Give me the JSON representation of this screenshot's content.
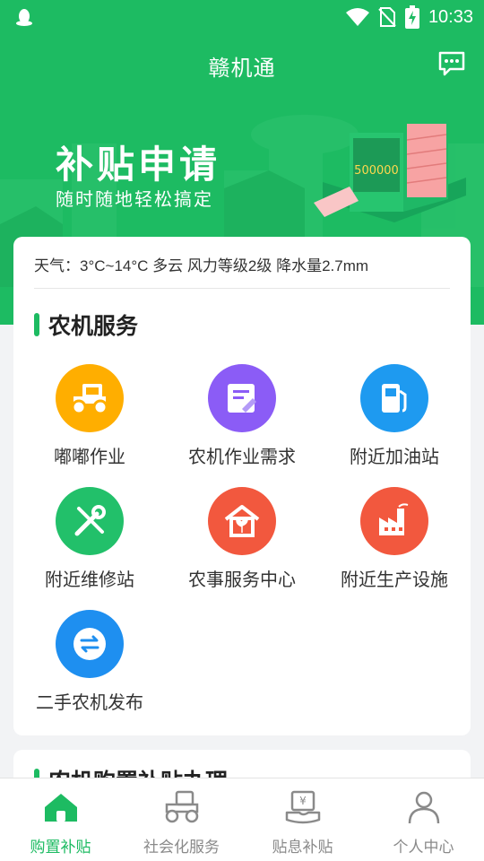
{
  "status_bar": {
    "time": "10:33"
  },
  "header": {
    "title": "赣机通",
    "message_icon": "chat-bubble-icon"
  },
  "banner": {
    "title": "补贴申请",
    "subtitle": "随时随地轻松搞定"
  },
  "weather": {
    "text": "天气：3°C~14°C 多云 风力等级2级 降水量2.7mm"
  },
  "services": {
    "title": "农机服务",
    "items": [
      {
        "label": "嘟嘟作业",
        "icon": "tractor-icon",
        "color": "#ffae00"
      },
      {
        "label": "农机作业需求",
        "icon": "document-edit-icon",
        "color": "#8b5cf6"
      },
      {
        "label": "附近加油站",
        "icon": "fuel-pump-icon",
        "color": "#1e9af0"
      },
      {
        "label": "附近维修站",
        "icon": "wrench-screwdriver-icon",
        "color": "#22c06a"
      },
      {
        "label": "农事服务中心",
        "icon": "house-plant-icon",
        "color": "#f2583e"
      },
      {
        "label": "附近生产设施",
        "icon": "factory-icon",
        "color": "#f2583e"
      },
      {
        "label": "二手农机发布",
        "icon": "exchange-icon",
        "color": "#1e8ff0"
      }
    ]
  },
  "subsidy_section": {
    "title": "农机购置补贴办理"
  },
  "tabbar": {
    "tabs": [
      {
        "label": "购置补贴",
        "icon": "home-icon",
        "active": true
      },
      {
        "label": "社会化服务",
        "icon": "tractor-outline-icon",
        "active": false
      },
      {
        "label": "贴息补贴",
        "icon": "yen-receipt-icon",
        "active": false
      },
      {
        "label": "个人中心",
        "icon": "person-icon",
        "active": false
      }
    ]
  },
  "colors": {
    "brand": "#1dbb62",
    "background": "#f2f3f5"
  }
}
